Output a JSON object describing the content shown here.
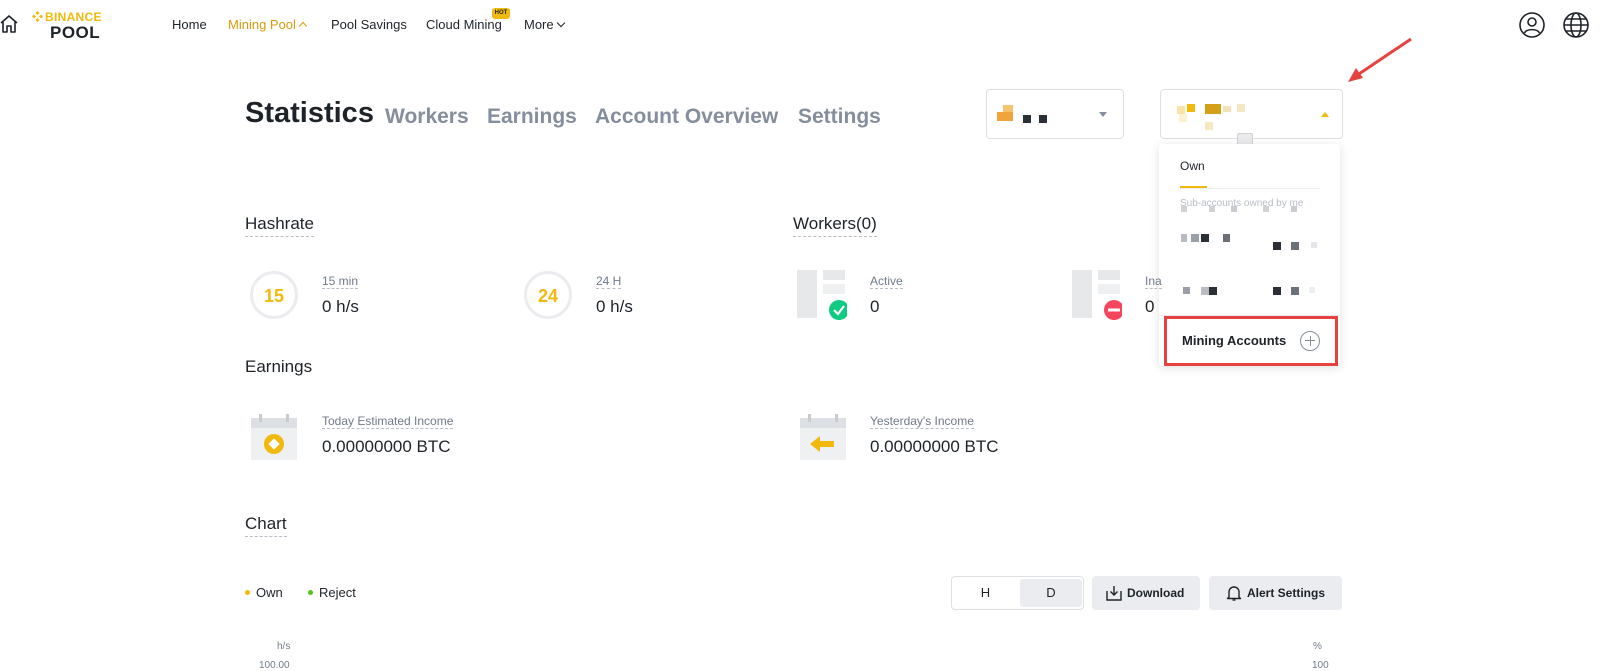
{
  "nav": {
    "logo_top": "BINANCE",
    "logo_bottom": "POOL",
    "items": [
      {
        "label": "Home"
      },
      {
        "label": "Mining Pool"
      },
      {
        "label": "Pool Savings"
      },
      {
        "label": "Cloud Mining"
      },
      {
        "label": "More"
      }
    ],
    "hot_badge": "HOT"
  },
  "tabs": [
    {
      "label": "Statistics"
    },
    {
      "label": "Workers"
    },
    {
      "label": "Earnings"
    },
    {
      "label": "Account Overview"
    },
    {
      "label": "Settings"
    }
  ],
  "dropdown": {
    "tab_own": "Own",
    "sub_label": "Sub-accounts owned by me",
    "mining_accounts": "Mining Accounts"
  },
  "hashrate": {
    "title": "Hashrate",
    "m15_icon": "15",
    "m15_label": "15 min",
    "m15_value": "0 h/s",
    "h24_icon": "24",
    "h24_label": "24 H",
    "h24_value": "0 h/s"
  },
  "workers": {
    "title": "Workers(0)",
    "active_label": "Active",
    "active_value": "0",
    "inactive_label": "Ina",
    "inactive_value": "0"
  },
  "earnings": {
    "title": "Earnings",
    "today_label": "Today Estimated Income",
    "today_value": "0.00000000 BTC",
    "yesterday_label": "Yesterday's Income",
    "yesterday_value": "0.00000000 BTC"
  },
  "chart": {
    "title": "Chart",
    "legend": [
      {
        "label": "Own",
        "color": "#f0b90b"
      },
      {
        "label": "Reject",
        "color": "#52c41a"
      }
    ],
    "toggle_h": "H",
    "toggle_d": "D",
    "download": "Download",
    "alert_settings": "Alert Settings",
    "y_left_unit": "h/s",
    "y_left_top": "100.00",
    "y_right_unit": "%",
    "y_right_top": "100"
  },
  "colors": {
    "brand": "#f0b90b",
    "highlight_red": "#e64340",
    "success": "#0ecb81",
    "danger": "#f6465d"
  }
}
